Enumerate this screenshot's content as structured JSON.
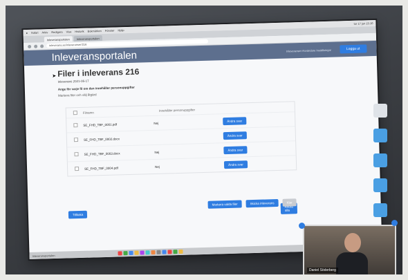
{
  "menubar": {
    "items": [
      "Safari",
      "Arkiv",
      "Redigera",
      "Visa",
      "Historik",
      "Bokmärken",
      "Fönster",
      "Hjälp"
    ],
    "clock": "tor 17 jun 15:10"
  },
  "browser": {
    "tabs": [
      "Inleveransportalen",
      "Inleveransportalen"
    ],
    "url": "inleverans.se/inleveranser/216"
  },
  "header": {
    "title": "Inleveransportalen",
    "links": "Inleveranser  Användare  Inställningar",
    "button": "Logga ut"
  },
  "page": {
    "title": "Filer i inleverans 216",
    "subtitle": "Inleverans 2021-06-17",
    "instruction": "Ange för varje fil om den innehåller personuppgifter",
    "hint": "Markera filer och välj åtgärd"
  },
  "table": {
    "columns": [
      "Filnamn",
      "Innehåller personuppgifter"
    ],
    "rows": [
      {
        "name": "SE_FHD_TBF_0001.pdf",
        "answer": "Nej",
        "button": "Ändra svar"
      },
      {
        "name": "SE_FHD_TBF_0002.docx",
        "answer": "",
        "button": "Ändra svar"
      },
      {
        "name": "SE_FHD_TBF_0003.docx",
        "answer": "Nej",
        "button": "Ändra svar"
      },
      {
        "name": "SE_FHD_TBF_0004.pdf",
        "answer": "Nej",
        "button": "Ändra svar"
      }
    ],
    "side_button": "Ändra alla"
  },
  "actions": {
    "left_button": "Tillbaka",
    "btn1": "Markera valda filer",
    "btn2": "Skicka inleverans",
    "btn3": "Klar"
  },
  "taskbar": {
    "label": "Inleveransportalen"
  },
  "webcam": {
    "name": "Daniel Söderberg"
  },
  "colors": {
    "header_bg": "#5d6f8e",
    "accent": "#2f7de1",
    "page_bg": "#f7f8fa"
  }
}
